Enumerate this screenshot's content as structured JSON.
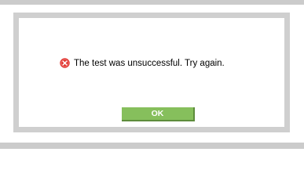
{
  "dialog": {
    "icon": "error-circle-x-icon",
    "message": "The test was unsuccessful. Try again.",
    "ok_label": "OK"
  },
  "colors": {
    "button_bg": "#86bf5c",
    "button_text": "#ffffff",
    "error_icon": "#e0322e",
    "frame": "#cfcfcf"
  }
}
